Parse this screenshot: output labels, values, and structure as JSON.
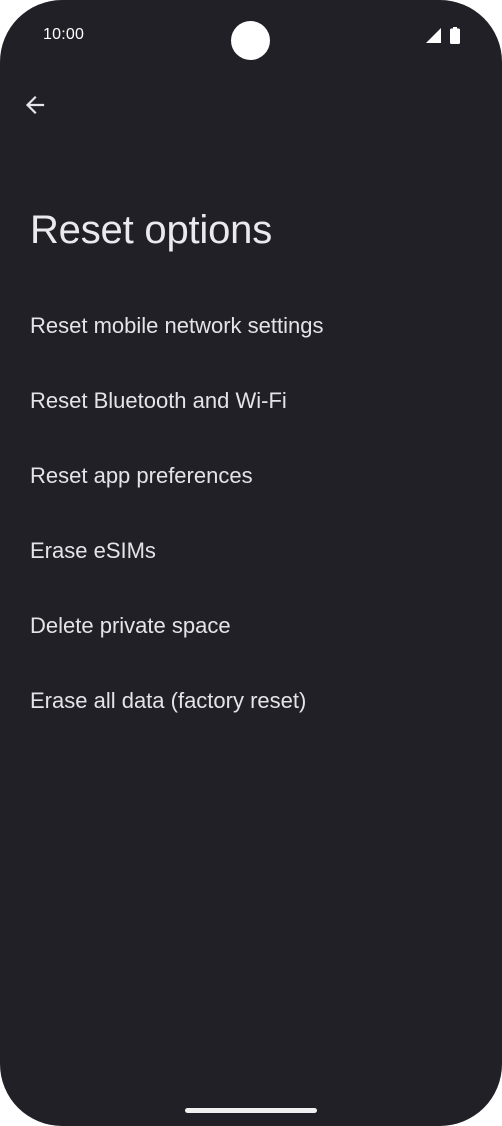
{
  "status_bar": {
    "time": "10:00",
    "icons": [
      "camera-cutout",
      "signal-icon",
      "battery-icon"
    ]
  },
  "toolbar": {
    "back_icon": "arrow-left-icon"
  },
  "page": {
    "title": "Reset options"
  },
  "menu": {
    "items": [
      {
        "label": "Reset mobile network settings"
      },
      {
        "label": "Reset Bluetooth and Wi-Fi"
      },
      {
        "label": "Reset app preferences"
      },
      {
        "label": "Erase eSIMs"
      },
      {
        "label": "Delete private space"
      },
      {
        "label": "Erase all data (factory reset)"
      }
    ]
  },
  "colors": {
    "background": "#202026",
    "text": "#e4e4e8",
    "status_icons": "#ffffff"
  }
}
